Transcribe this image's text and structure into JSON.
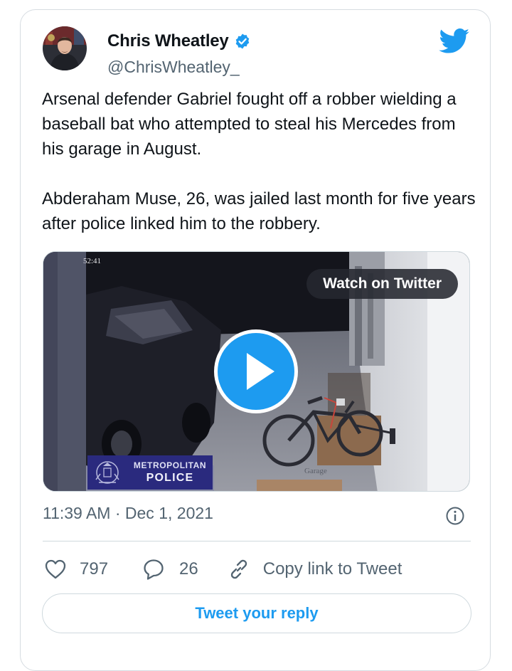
{
  "author": {
    "name": "Chris Wheatley",
    "handle": "@ChrisWheatley_",
    "verified": true,
    "avatar_icon": "avatar-photo"
  },
  "tweet": {
    "paragraphs": [
      "Arsenal defender Gabriel fought off a robber wielding a baseball bat who attempted to steal his Mercedes from his garage in August.",
      "Abderaham Muse, 26, was jailed last month for five years after police linked him to the robbery."
    ],
    "timestamp": "11:39 AM · Dec 1, 2021"
  },
  "media": {
    "type": "video",
    "overlay_button": "Watch on Twitter",
    "camera_time": "52:41",
    "camera_label": "Garage",
    "police_badge": {
      "line1": "METROPOLITAN",
      "line2": "POLICE"
    }
  },
  "actions": {
    "likes": "797",
    "replies": "26",
    "copy_link": "Copy link to Tweet"
  },
  "reply_button": "Tweet your reply",
  "colors": {
    "twitter_blue": "#1d9bf0",
    "text_primary": "#0f1419",
    "text_secondary": "#536471",
    "border": "#cfd9de",
    "police_blue": "#2a2a7e"
  },
  "icons": {
    "brand": "twitter-bird-icon",
    "verified": "verified-badge-icon",
    "play": "play-icon",
    "info": "info-icon",
    "like": "heart-icon",
    "reply": "comment-bubble-icon",
    "copy": "link-icon"
  }
}
